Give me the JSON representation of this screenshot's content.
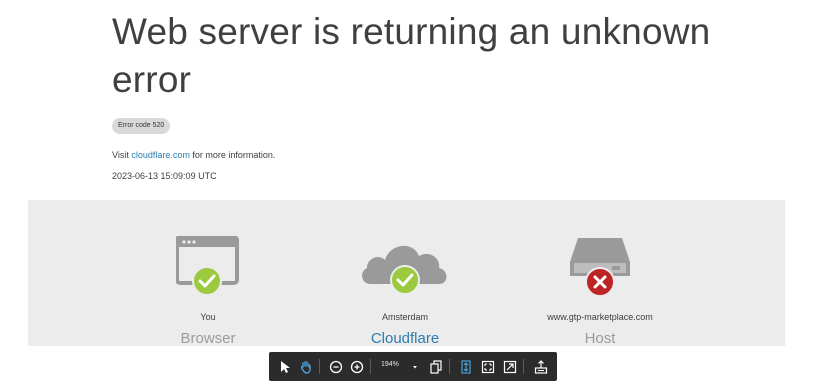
{
  "page": {
    "title": "Web server is returning an unknown error",
    "error_code": "Error code 520",
    "visit_prefix": "Visit ",
    "visit_link": "cloudflare.com",
    "visit_suffix": " for more information.",
    "timestamp": "2023-06-13 15:09:09 UTC"
  },
  "status": {
    "nodes": [
      {
        "location": "You",
        "type": "Browser",
        "state": "ok",
        "icon": "browser-icon"
      },
      {
        "location": "Amsterdam",
        "type": "Cloudflare",
        "state": "ok",
        "icon": "cloud-icon"
      },
      {
        "location": "www.gtp-marketplace.com",
        "type": "Host",
        "state": "error",
        "icon": "server-icon"
      }
    ],
    "ok_color": "#9bca3e",
    "error_color": "#bd2426"
  },
  "toolbar": {
    "zoom": "194%",
    "icons": [
      "select-arrow-icon",
      "hand-tool-icon",
      "zoom-out-icon",
      "zoom-in-icon",
      "chevron-down-icon",
      "copy-pages-icon",
      "fit-height-icon",
      "fit-page-icon",
      "fit-width-icon",
      "export-icon"
    ],
    "accent": "#4aa3df"
  }
}
